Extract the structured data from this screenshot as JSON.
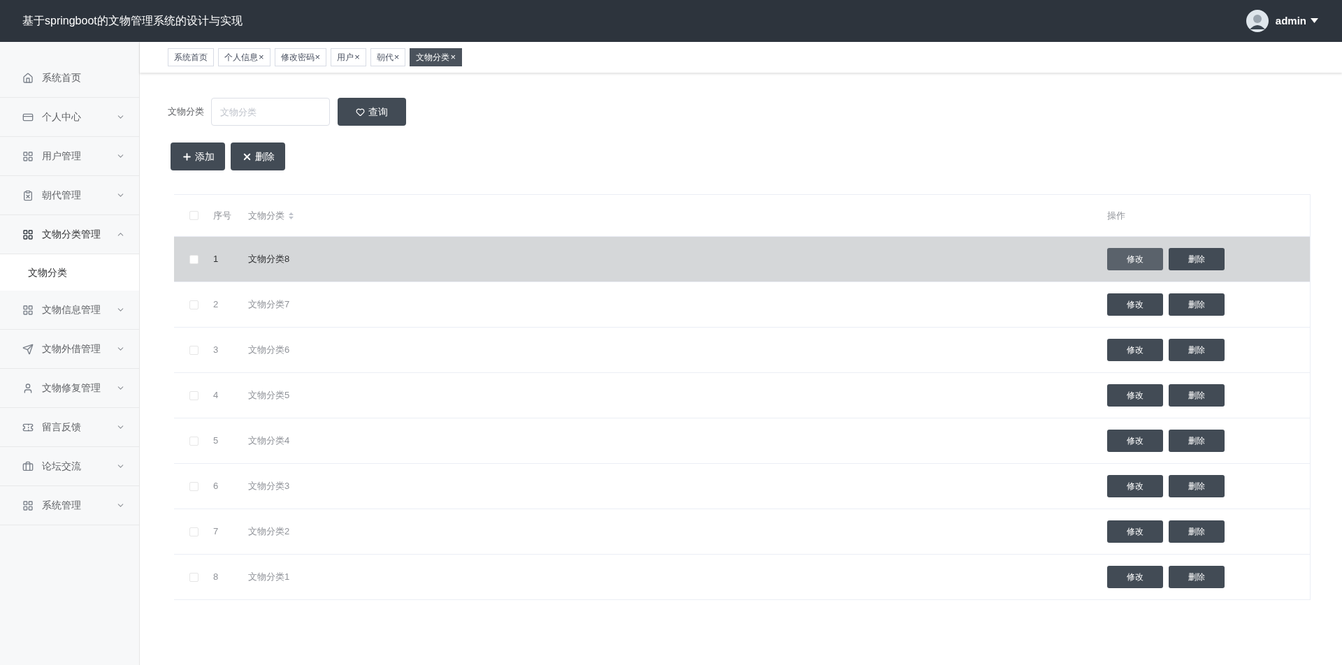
{
  "header": {
    "title": "基于springboot的文物管理系统的设计与实现",
    "user": "admin"
  },
  "sidebar": {
    "items": [
      {
        "label": "系统首页",
        "expandable": false,
        "expanded": false
      },
      {
        "label": "个人中心",
        "expandable": true,
        "expanded": false
      },
      {
        "label": "用户管理",
        "expandable": true,
        "expanded": false
      },
      {
        "label": "朝代管理",
        "expandable": true,
        "expanded": false
      },
      {
        "label": "文物分类管理",
        "expandable": true,
        "expanded": true,
        "children": [
          {
            "label": "文物分类",
            "selected": true
          }
        ]
      },
      {
        "label": "文物信息管理",
        "expandable": true,
        "expanded": false
      },
      {
        "label": "文物外借管理",
        "expandable": true,
        "expanded": false
      },
      {
        "label": "文物修复管理",
        "expandable": true,
        "expanded": false
      },
      {
        "label": "留言反馈",
        "expandable": true,
        "expanded": false
      },
      {
        "label": "论坛交流",
        "expandable": true,
        "expanded": false
      },
      {
        "label": "系统管理",
        "expandable": true,
        "expanded": false
      }
    ]
  },
  "tabs": [
    {
      "label": "系统首页",
      "closable": false,
      "selected": false
    },
    {
      "label": "个人信息",
      "closable": true,
      "selected": false
    },
    {
      "label": "修改密码",
      "closable": true,
      "selected": false
    },
    {
      "label": "用户",
      "closable": true,
      "selected": false
    },
    {
      "label": "朝代",
      "closable": true,
      "selected": false
    },
    {
      "label": "文物分类",
      "closable": true,
      "selected": true
    }
  ],
  "close_glyph": "×",
  "search": {
    "label": "文物分类",
    "placeholder": "文物分类",
    "button": "查询"
  },
  "actions": {
    "add": "添加",
    "delete": "删除"
  },
  "table": {
    "columns": [
      "序号",
      "文物分类",
      "操作"
    ],
    "rows": [
      {
        "index": "1",
        "name": "文物分类8",
        "selected": true,
        "checked": false,
        "edit": "修改",
        "delete": "删除"
      },
      {
        "index": "2",
        "name": "文物分类7",
        "selected": false,
        "checked": false,
        "edit": "修改",
        "delete": "删除"
      },
      {
        "index": "3",
        "name": "文物分类6",
        "selected": false,
        "checked": false,
        "edit": "修改",
        "delete": "删除"
      },
      {
        "index": "4",
        "name": "文物分类5",
        "selected": false,
        "checked": false,
        "edit": "修改",
        "delete": "删除"
      },
      {
        "index": "5",
        "name": "文物分类4",
        "selected": false,
        "checked": false,
        "edit": "修改",
        "delete": "删除"
      },
      {
        "index": "6",
        "name": "文物分类3",
        "selected": false,
        "checked": false,
        "edit": "修改",
        "delete": "删除"
      },
      {
        "index": "7",
        "name": "文物分类2",
        "selected": false,
        "checked": false,
        "edit": "修改",
        "delete": "删除"
      },
      {
        "index": "8",
        "name": "文物分类1",
        "selected": false,
        "checked": false,
        "edit": "修改",
        "delete": "删除"
      }
    ],
    "all_checked": false
  }
}
